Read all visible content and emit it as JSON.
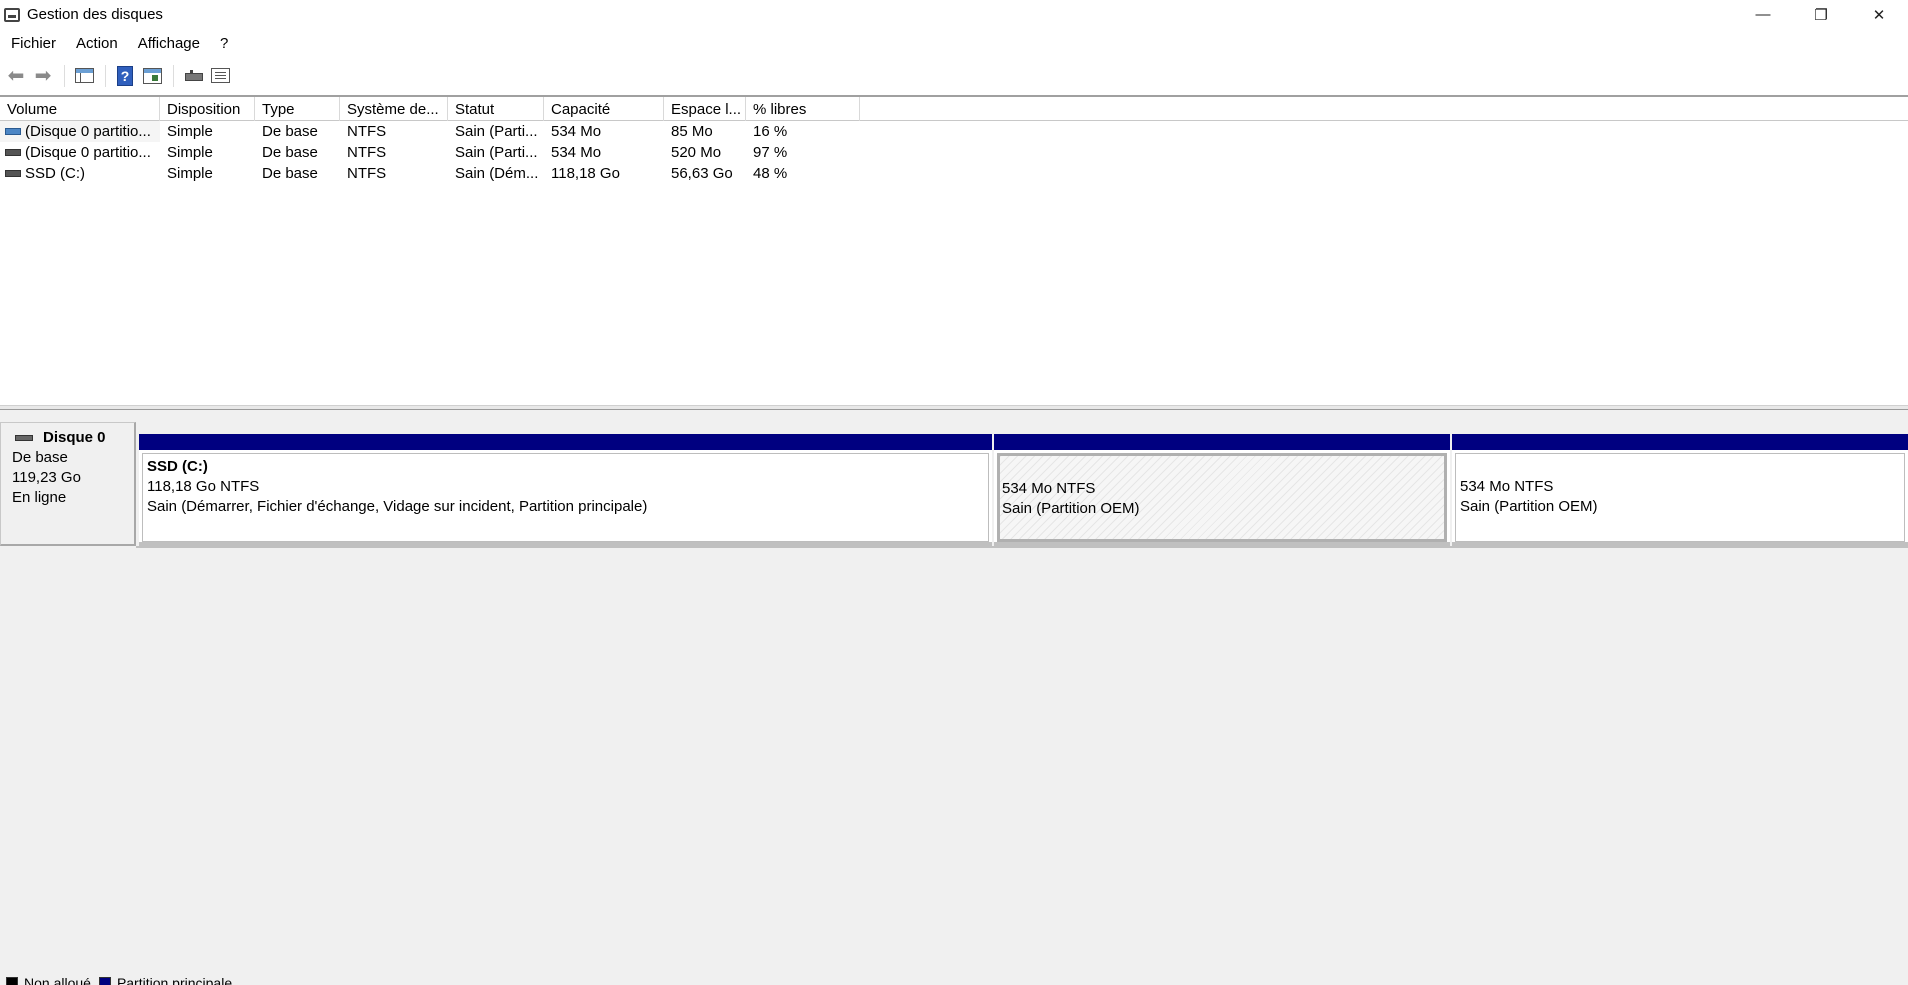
{
  "window": {
    "title": "Gestion des disques",
    "controls": {
      "minimize": "—",
      "restore": "❐",
      "close": "✕"
    }
  },
  "menu": {
    "items": [
      "Fichier",
      "Action",
      "Affichage",
      "?"
    ]
  },
  "toolbar": {
    "icons": [
      "back-arrow-icon",
      "forward-arrow-icon",
      "console-tree-icon",
      "help-icon",
      "action-pane-icon",
      "disk-properties-icon",
      "list-view-icon"
    ]
  },
  "volume_list": {
    "columns": [
      "Volume",
      "Disposition",
      "Type",
      "Système de...",
      "Statut",
      "Capacité",
      "Espace l...",
      "% libres"
    ],
    "rows": [
      {
        "volume": "(Disque 0 partitio...",
        "disposition": "Simple",
        "type": "De base",
        "fs": "NTFS",
        "status": "Sain (Parti...",
        "capacity": "534 Mo",
        "free": "85 Mo",
        "pct": "16 %",
        "icon_color": "#4c86c5"
      },
      {
        "volume": "(Disque 0 partitio...",
        "disposition": "Simple",
        "type": "De base",
        "fs": "NTFS",
        "status": "Sain (Parti...",
        "capacity": "534 Mo",
        "free": "520 Mo",
        "pct": "97 %",
        "icon_color": "#555555"
      },
      {
        "volume": "SSD (C:)",
        "disposition": "Simple",
        "type": "De base",
        "fs": "NTFS",
        "status": "Sain (Dém...",
        "capacity": "118,18 Go",
        "free": "56,63 Go",
        "pct": "48 %",
        "icon_color": "#555555"
      }
    ]
  },
  "disk": {
    "name": "Disque 0",
    "kind": "De base",
    "size": "119,23 Go",
    "state": "En ligne",
    "partitions": [
      {
        "name": "SSD  (C:)",
        "size_fs": "118,18 Go NTFS",
        "status": "Sain (Démarrer, Fichier d'échange, Vidage sur incident, Partition principale)"
      },
      {
        "name": "",
        "size_fs": "534 Mo NTFS",
        "status": "Sain (Partition OEM)"
      },
      {
        "name": "",
        "size_fs": "534 Mo NTFS",
        "status": "Sain (Partition OEM)"
      }
    ]
  },
  "legend": {
    "items": [
      {
        "label": "Non alloué",
        "color": "#000000"
      },
      {
        "label": "Partition principale",
        "color": "#000080"
      }
    ]
  },
  "colors": {
    "partition_header": "#000080",
    "background": "#f0f0f0"
  }
}
